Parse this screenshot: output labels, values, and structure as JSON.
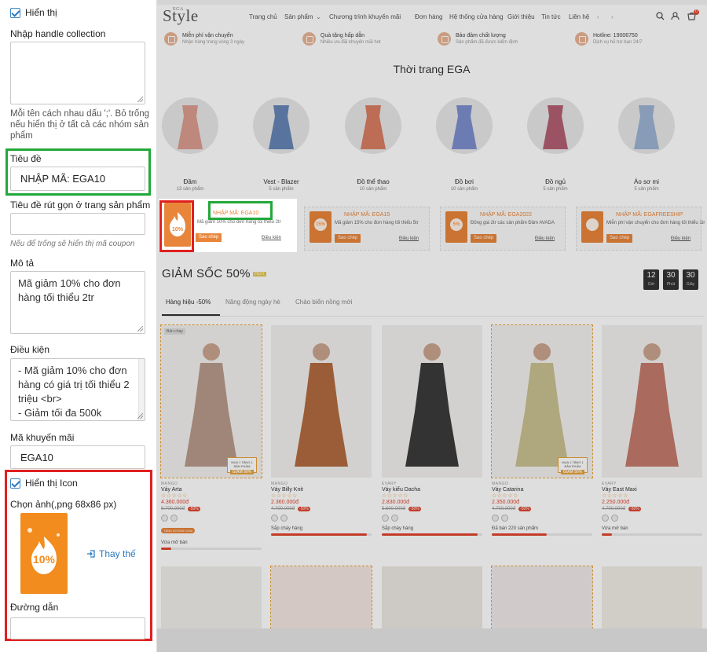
{
  "panel": {
    "show_label": "Hiển thị",
    "collection_label": "Nhập handle collection",
    "collection_help": "Mỗi tên cách nhau dấu ';'. Bỏ trống nếu hiển thị ở tất cả các nhóm sản phẩm",
    "title_label": "Tiêu đề",
    "title_value": "NHẬP MÃ: EGA10",
    "short_title_label": "Tiêu đề rút gọn ở trang sản phẩm",
    "short_title_help": "Nếu để trống sẽ hiển thị mã coupon",
    "desc_label": "Mô tả",
    "desc_value": "Mã giảm 10% cho đơn hàng tối thiểu 2tr",
    "cond_label": "Điều kiện",
    "cond_value": "- Mã giảm 10% cho đơn hàng có giá trị tối thiểu 2 triệu <br>\n- Giảm tối đa 500k",
    "promo_label": "Mã khuyến mãi",
    "promo_value": "EGA10",
    "show_icon_label": "Hiển thị Icon",
    "choose_image_label": "Chọn ảnh(,png 68x86 px)",
    "icon_text": "10%",
    "replace_label": "Thay thế",
    "link_label": "Đường dẫn"
  },
  "store": {
    "logo_small": "EGA",
    "logo": "Style",
    "nav": [
      "Trang chủ",
      "Sản phẩm",
      "Chương trình khuyến mãi",
      "Đơn hàng",
      "Hệ thống cửa hàng",
      "Giới thiệu",
      "Tin tức",
      "Liên hệ"
    ],
    "cart_count": "0",
    "services": [
      {
        "title": "Miễn phí vận chuyển",
        "sub": "Nhận hàng trong vòng 3 ngày"
      },
      {
        "title": "Quà tặng hấp dẫn",
        "sub": "Nhiều ưu đãi khuyến mãi hot"
      },
      {
        "title": "Bảo đảm chất lượng",
        "sub": "Sản phẩm đã được kiểm định"
      },
      {
        "title": "Hotline: 19006750",
        "sub": "Dịch vụ hỗ trợ bạn 24/7"
      }
    ],
    "section_title": "Thời trang EGA",
    "categories": [
      {
        "name": "Đầm",
        "count": "13 sản phẩm",
        "color": "#d98f80"
      },
      {
        "name": "Vest - Blazer",
        "count": "5 sản phẩm",
        "color": "#4f74ad"
      },
      {
        "name": "Đồ thể thao",
        "count": "10 sản phẩm",
        "color": "#d76b4a"
      },
      {
        "name": "Đồ bơi",
        "count": "10 sản phẩm",
        "color": "#6a7fc9"
      },
      {
        "name": "Đồ ngủ",
        "count": "5 sản phẩm",
        "color": "#a8485d"
      },
      {
        "name": "Áo sơ mi",
        "count": "5 sản phẩm",
        "color": "#8fa8cf"
      }
    ],
    "coupons": [
      {
        "code": "NHẬP MÃ: EGA10",
        "desc": "Mã giảm 10% cho đơn hàng tối thiểu 2tr",
        "icon": "10%",
        "btn": "Sao chép",
        "cond": "Điều kiện"
      },
      {
        "code": "NHẬP MÃ: EGA15",
        "desc": "Mã giảm 15% cho đơn hàng tối thiểu 5tr",
        "icon": "15%",
        "btn": "Sao chép",
        "cond": "Điều kiện"
      },
      {
        "code": "NHẬP MÃ: EGA2022",
        "desc": "Đồng giá 2tr các sản phẩm Đầm AVADA",
        "icon": "5%",
        "btn": "Sao chép",
        "cond": "Điều kiện"
      },
      {
        "code": "NHẬP MÃ: EGAFREESHIP",
        "desc": "Miễn phí vận chuyển cho đơn hàng tối thiểu 1tr",
        "icon": "",
        "btn": "Sao chép",
        "cond": "Điều kiện"
      }
    ],
    "flash_title": "GIẢM SỐC 50%",
    "hot": "HOT",
    "countdown": [
      {
        "n": "12",
        "u": "Giờ"
      },
      {
        "n": "30",
        "u": "Phút"
      },
      {
        "n": "30",
        "u": "Giây"
      }
    ],
    "tabs": [
      "Hàng hiệu -50%",
      "Năng động ngày hè",
      "Chào biển nồng mới"
    ],
    "products": [
      {
        "brand": "MANGO",
        "name": "Váy Arta",
        "stars": "☆☆☆☆☆",
        "price": "4.360.000đ",
        "old": "8.700.000đ",
        "disc": "-50%",
        "stock": "Vừa mở bán",
        "sold": 0.1,
        "badge": "Bán chạy",
        "tag": "GIẢM 50%",
        "tagtop": "MUA 1 TẶNG 1 BẢN PHẨM",
        "coupon": "TẶNG 50 RUN CHAI",
        "color": "#b89a8a"
      },
      {
        "brand": "MANGO",
        "name": "Váy Billy Knit",
        "stars": "☆☆☆☆☆",
        "price": "2.360.000đ",
        "old": "4.700.000đ",
        "disc": "-50%",
        "stock": "Sắp cháy hàng",
        "sold": 0.95,
        "color": "#b26b40"
      },
      {
        "brand": "EVARY",
        "name": "Váy kiểu Dacha",
        "stars": "☆☆☆☆☆",
        "price": "2.830.000đ",
        "old": "5.600.000đ",
        "disc": "-50%",
        "stock": "Sắp cháy hàng",
        "sold": 0.95,
        "color": "#3b3b3b"
      },
      {
        "brand": "MANGO",
        "name": "Váy Catarina",
        "stars": "☆☆☆☆☆",
        "price": "2.350.000đ",
        "old": "4.700.000đ",
        "disc": "-50%",
        "stock": "Đã bán 220 sản phẩm",
        "sold": 0.55,
        "tag": "GIẢM 50%",
        "tagtop": "MUA 1 TẶNG 1 BẢN PHẨM",
        "color": "#c9c090"
      },
      {
        "brand": "EVARY",
        "name": "Váy East Maxi",
        "stars": "☆☆☆☆☆",
        "price": "2.250.000đ",
        "old": "4.700.000đ",
        "disc": "-50%",
        "stock": "Vừa mở bán",
        "sold": 0.1,
        "color": "#c47a6b"
      }
    ]
  },
  "colors": {
    "accent": "#e8853a",
    "green_highlight": "#22a83a",
    "red_highlight": "#e02020",
    "sale": "#e0462f"
  }
}
